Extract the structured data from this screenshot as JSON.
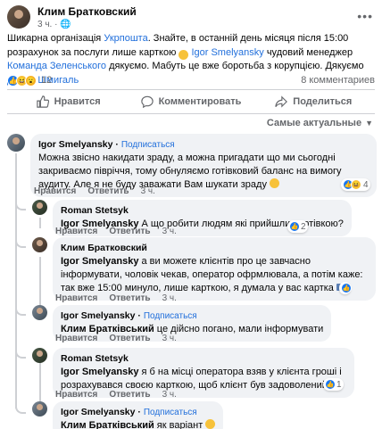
{
  "post": {
    "author": "Клим Братковский",
    "time": "3 ч.",
    "text_parts": [
      {
        "t": "Шикарна організація ",
        "c": ""
      },
      {
        "t": "Укрпошта",
        "c": "link"
      },
      {
        "t": ". Знайте, в останній день місяця після 15:00 розрахунок за послуги лише карткою ",
        "c": ""
      },
      {
        "t": "😊",
        "c": "emoji"
      },
      {
        "t": " ",
        "c": ""
      },
      {
        "t": "Igor Smelyansky",
        "c": "link"
      },
      {
        "t": "  чудовий менеджер ",
        "c": ""
      },
      {
        "t": "Команда Зеленського",
        "c": "link"
      },
      {
        "t": " дякуємо. Мабуть це вже боротьба з корупцією. Дякуємо ",
        "c": ""
      },
      {
        "t": "Денис Шмигаль",
        "c": "link"
      }
    ],
    "reaction_count": "12",
    "comments_count": "8 комментариев"
  },
  "actions": {
    "like": "Нравится",
    "comment": "Комментировать",
    "share": "Поделиться"
  },
  "sort_label": "Самые актуальные",
  "comments": [
    {
      "name": "Igor Smelyansky",
      "follow": "Подписаться",
      "text": "Можна звісно накидати зраду, а можна пригадати що ми сьогодні закриваємо півріччя, тому обнуляємо готівковий баланс на вимогу аудиту. Але я не буду заважати Вам шукати зраду",
      "like": "Нравится",
      "reply": "Ответить",
      "time": "3 ч.",
      "reactions": "4"
    },
    {
      "name": "Roman Stetsyk",
      "mention": "Igor Smelyansky",
      "text": " А що робити людям які прийшли з готівкою?",
      "like": "Нравится",
      "reply": "Ответить",
      "time": "3 ч.",
      "reactions": "2"
    },
    {
      "name": "Клим Братковский",
      "mention": "Igor Smelyansky",
      "text": " а ви можете клієнтів про це завчасно інформувати, чоловік чекав, оператор офрмлювала, а потім каже: так вже 15:00 минуло, лише карткою, я думала у вас картка",
      "like": "Нравится",
      "reply": "Ответить",
      "time": "3 ч.",
      "reactions": ""
    },
    {
      "name": "Igor Smelyansky",
      "follow": "Подписаться",
      "mention": "Клим Братківський",
      "text": " це дійсно погано, мали інформувати",
      "like": "Нравится",
      "reply": "Ответить",
      "time": "3 ч."
    },
    {
      "name": "Roman Stetsyk",
      "mention": "Igor Smelyansky",
      "text": " я б на місці оператора взяв у клієнта гроші і розрахувався своєю карткою, щоб клієнт був задоволений",
      "like": "Нравится",
      "reply": "Ответить",
      "time": "3 ч.",
      "reactions": "1"
    },
    {
      "name": "Igor Smelyansky",
      "follow": "Подписаться",
      "mention": "Клим Братківський",
      "text": " як варіант"
    }
  ],
  "colors": {
    "link": "#216fdb",
    "bubble": "#f0f2f5",
    "muted": "#65676b"
  }
}
